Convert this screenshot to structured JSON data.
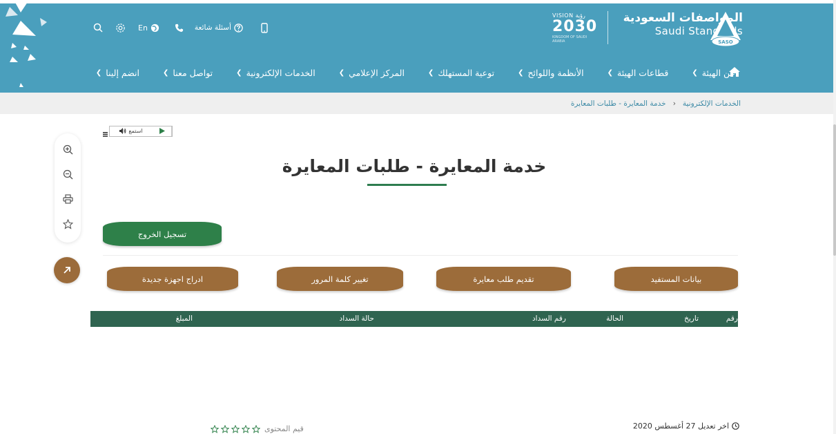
{
  "topbar": {
    "language_label": "En",
    "faq_label": "أسئلة شائعة"
  },
  "brand": {
    "name_ar": "المواصفات السعودية",
    "name_en": "Saudi Standards",
    "logo_text": "SASO",
    "vision_top": "VISION رؤية",
    "vision_year": "2030",
    "vision_sub": "KINGDOM OF SAUDI ARABIA"
  },
  "nav": {
    "items": [
      {
        "label": "عن الهيئة"
      },
      {
        "label": "قطاعات الهيئة"
      },
      {
        "label": "الأنظمة واللوائح"
      },
      {
        "label": "توعية المستهلك"
      },
      {
        "label": "المركز الإعلامي"
      },
      {
        "label": "الخدمات الإلكترونية"
      },
      {
        "label": "تواصل معنا"
      },
      {
        "label": "انضم إلينا"
      }
    ]
  },
  "breadcrumb": {
    "items": [
      "الخدمات الإلكترونية",
      "خدمة المعايرة - طلبات المعايرة"
    ]
  },
  "listen": {
    "label": "استمع"
  },
  "page": {
    "title": "خدمة المعايرة - طلبات المعايرة"
  },
  "actions": {
    "logout": "تسجيل الخروج",
    "beneficiary_data": "بيانات المستفيد",
    "submit_request": "تقديم طلب معايرة",
    "change_password": "تغيير كلمة المرور",
    "add_devices": "ادراج اجهزة جديدة"
  },
  "table": {
    "columns": [
      "رقم",
      "تاريخ",
      "الحالة",
      "رقم السداد",
      "حالة السداد",
      "المبلغ"
    ]
  },
  "footer": {
    "last_modified": "اخر تعديل 27 أغسطس 2020",
    "rating_label": "قيم المحتوى"
  },
  "colors": {
    "header_bg": "#4a9fbd",
    "primary_green": "#2e8049",
    "brown": "#9c6c3a",
    "table_header": "#2f6450"
  }
}
